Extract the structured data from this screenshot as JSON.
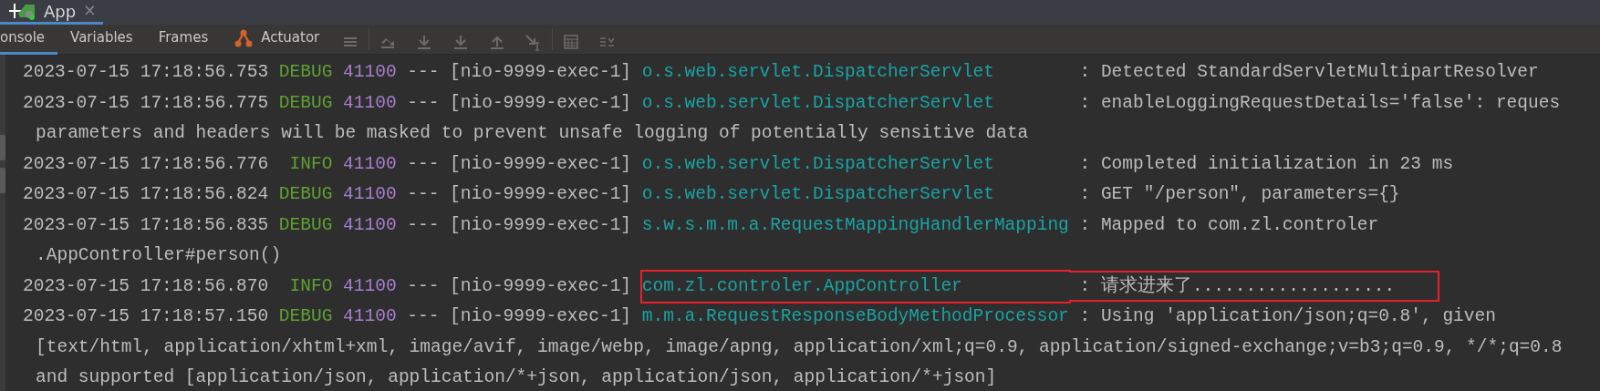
{
  "window": {
    "tab": {
      "title": "App",
      "close": "×"
    }
  },
  "tabs": [
    {
      "label": "onsole",
      "selected": true,
      "has_icon": false
    },
    {
      "label": "Variables",
      "selected": false,
      "has_icon": false
    },
    {
      "label": "Frames",
      "selected": false,
      "has_icon": false
    },
    {
      "label": "Actuator",
      "selected": false,
      "has_icon": true
    }
  ],
  "toolbar_buttons": [
    {
      "kind": "lines",
      "disabled": true
    },
    {
      "kind": "step",
      "disabled": true
    },
    {
      "kind": "down",
      "disabled": true
    },
    {
      "kind": "down",
      "disabled": true
    },
    {
      "kind": "up",
      "disabled": true
    },
    {
      "kind": "cursor",
      "disabled": true
    },
    {
      "kind": "grid",
      "disabled": true
    },
    {
      "kind": "list",
      "disabled": true
    }
  ],
  "console": {
    "lines": [
      {
        "kind": "entry",
        "time": "2023-07-15 17:18:56.753",
        "level": "DEBUG",
        "pid": "41100",
        "sep": "---",
        "thread": "[nio-9999-exec-1]",
        "logger": "o.s.web.servlet.DispatcherServlet",
        "message": ": Detected StandardServletMultipartResolver",
        "highlighted": false
      },
      {
        "kind": "entry",
        "time": "2023-07-15 17:18:56.775",
        "level": "DEBUG",
        "pid": "41100",
        "sep": "---",
        "thread": "[nio-9999-exec-1]",
        "logger": "o.s.web.servlet.DispatcherServlet",
        "message": ": enableLoggingRequestDetails='false': reques",
        "highlighted": false
      },
      {
        "kind": "continuation",
        "text": "parameters and headers will be masked to prevent unsafe logging of potentially sensitive data"
      },
      {
        "kind": "entry",
        "time": "2023-07-15 17:18:56.776",
        "level": "INFO",
        "pid": "41100",
        "sep": "---",
        "thread": "[nio-9999-exec-1]",
        "logger": "o.s.web.servlet.DispatcherServlet",
        "message": ": Completed initialization in 23 ms",
        "highlighted": false
      },
      {
        "kind": "entry",
        "time": "2023-07-15 17:18:56.824",
        "level": "DEBUG",
        "pid": "41100",
        "sep": "---",
        "thread": "[nio-9999-exec-1]",
        "logger": "o.s.web.servlet.DispatcherServlet",
        "message": ": GET \"/person\", parameters={}",
        "highlighted": false
      },
      {
        "kind": "entry",
        "time": "2023-07-15 17:18:56.835",
        "level": "DEBUG",
        "pid": "41100",
        "sep": "---",
        "thread": "[nio-9999-exec-1]",
        "logger": "s.w.s.m.m.a.RequestMappingHandlerMapping",
        "message": ": Mapped to com.zl.controler",
        "highlighted": false
      },
      {
        "kind": "continuation",
        "text": ".AppController#person()"
      },
      {
        "kind": "entry",
        "time": "2023-07-15 17:18:56.870",
        "level": "INFO",
        "pid": "41100",
        "sep": "---",
        "thread": "[nio-9999-exec-1]",
        "logger": "com.zl.controler.AppController",
        "message": ": 请求进来了...................",
        "highlighted": true
      },
      {
        "kind": "entry",
        "time": "2023-07-15 17:18:57.150",
        "level": "DEBUG",
        "pid": "41100",
        "sep": "---",
        "thread": "[nio-9999-exec-1]",
        "logger": "m.m.a.RequestResponseBodyMethodProcessor",
        "message": ": Using 'application/json;q=0.8', given",
        "highlighted": false
      },
      {
        "kind": "continuation",
        "text": "[text/html, application/xhtml+xml, image/avif, image/webp, image/apng, application/xml;q=0.9, application/signed-exchange;v=b3;q=0.9, */*;q=0.8"
      },
      {
        "kind": "continuation",
        "text": "and supported [application/json, application/*+json, application/json, application/*+json]"
      }
    ]
  }
}
